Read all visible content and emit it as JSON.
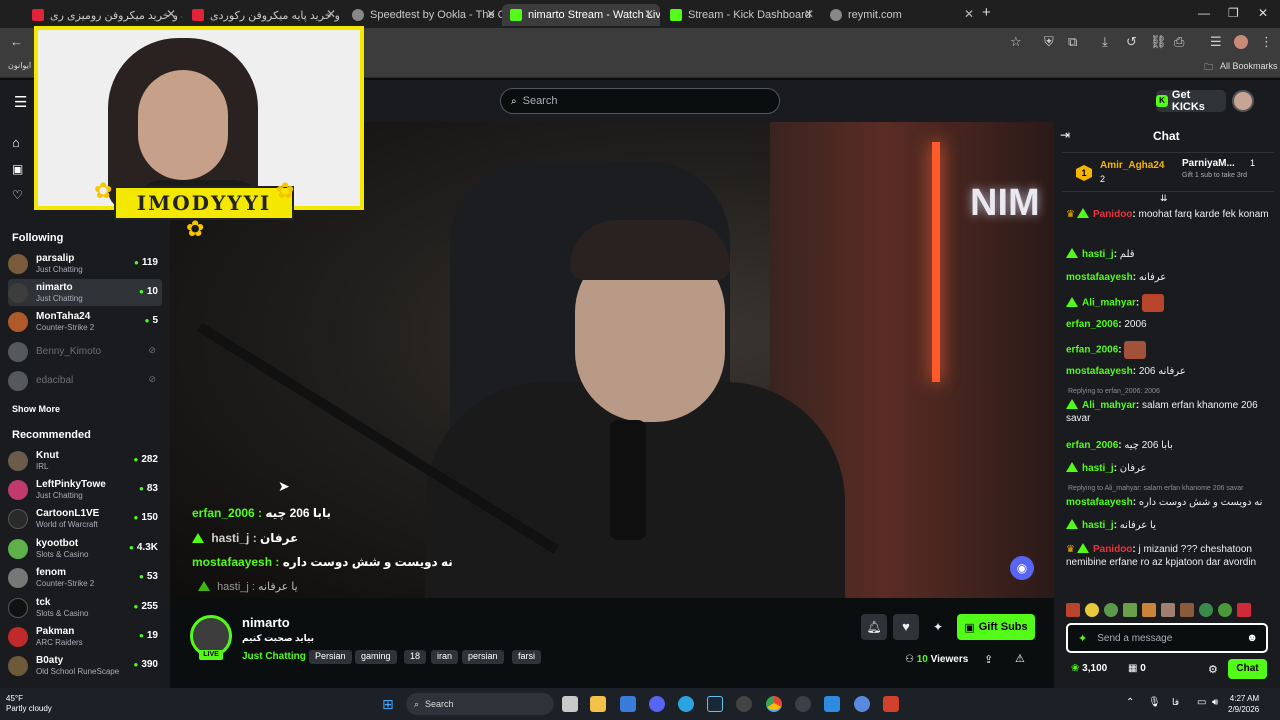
{
  "browser": {
    "tabs": [
      {
        "title": "قیمت و خرید میکروفن رومیزی ری",
        "fav": "#e0243a"
      },
      {
        "title": "قیمت و خرید پایه میکروفن رکوردی",
        "fav": "#e0243a"
      },
      {
        "title": "Speedtest by Ookla - The Glob",
        "fav": "#888888"
      },
      {
        "title": "nimarto Stream - Watch Live",
        "fav": "#53fc18"
      },
      {
        "title": "Stream - Kick Dashboard",
        "fav": "#53fc18"
      },
      {
        "title": "reymit.com",
        "fav": "#888888"
      }
    ],
    "bookmarks_label": "All Bookmarks",
    "bookmark_item": "ایوانون"
  },
  "header": {
    "search_placeholder": "Search",
    "get_kicks": "Get KICKs"
  },
  "sidebar": {
    "following_title": "Following",
    "following": [
      {
        "name": "parsalip",
        "category": "Just Chatting",
        "viewers": "119",
        "color": "#7a5c3c"
      },
      {
        "name": "nimarto",
        "category": "Just Chatting",
        "viewers": "10",
        "color": "#3d3d3d"
      },
      {
        "name": "MonTaha24",
        "category": "Counter-Strike 2",
        "viewers": "5",
        "color": "#b05a2c"
      },
      {
        "name": "Benny_Kimoto",
        "category": "",
        "viewers": "",
        "color": "#55585c"
      },
      {
        "name": "edacibal",
        "category": "",
        "viewers": "",
        "color": "#55585c"
      }
    ],
    "show_more": "Show More",
    "recommended_title": "Recommended",
    "recommended": [
      {
        "name": "Knut",
        "category": "IRL",
        "viewers": "282",
        "color": "#6b5b4b"
      },
      {
        "name": "LeftPinkyTowe",
        "category": "Just Chatting",
        "viewers": "83",
        "color": "#c03a6a"
      },
      {
        "name": "CartoonL1VE",
        "category": "World of Warcraft",
        "viewers": "150",
        "color": "#2a2a2a"
      },
      {
        "name": "kyootbot",
        "category": "Slots & Casino",
        "viewers": "4.3K",
        "color": "#5fb04a"
      },
      {
        "name": "fenom",
        "category": "Counter-Strike 2",
        "viewers": "53",
        "color": "#777777"
      },
      {
        "name": "tck",
        "category": "Slots & Casino",
        "viewers": "255",
        "color": "#111111"
      },
      {
        "name": "Pakman",
        "category": "ARC Raiders",
        "viewers": "19",
        "color": "#c02a2a"
      },
      {
        "name": "B0aty",
        "category": "Old School RuneScape",
        "viewers": "390",
        "color": "#6c5a3a"
      }
    ]
  },
  "webcam": {
    "label": "IMODYYYI"
  },
  "video_overlay_chat": [
    {
      "user": "erfan_2006 :",
      "text": "بابا 206 چیه"
    },
    {
      "user": "hasti_j :",
      "text": "عرفان"
    },
    {
      "user": "mostafaayesh :",
      "text": "نه دویست و شش دوست داره"
    },
    {
      "user": "hasti_j :",
      "text": "یا عرفانه"
    }
  ],
  "stream": {
    "channel": "nimarto",
    "title": "بیاید صحبت کنیم",
    "live_badge": "LIVE",
    "category": "Just Chatting",
    "tags": [
      "Persian",
      "gaming",
      "18",
      "iran",
      "persian",
      "farsi"
    ],
    "viewers_count": "10",
    "viewers_label": "Viewers",
    "gift_subs": "Gift Subs"
  },
  "chat": {
    "title": "Chat",
    "leader1": {
      "name": "Amir_Agha24",
      "count": "2"
    },
    "leader2": {
      "name": "ParniyaM...",
      "count": "1",
      "note": "Gift 1 sub to take 3rd"
    },
    "messages": [
      {
        "user": "Panidoo",
        "text": "moohat farq karde fek konam",
        "color": "#e8353d",
        "crown": true
      },
      {
        "user": "hasti_j",
        "text": "قلم",
        "color": "#53fc18",
        "tri": true
      },
      {
        "user": "mostafaayesh",
        "text": "عرفانه",
        "color": "#53fc18"
      },
      {
        "user": "Ali_mahyar",
        "text": "",
        "color": "#53fc18",
        "tri": true
      },
      {
        "user": "erfan_2006",
        "text": "2006",
        "color": "#53fc18"
      },
      {
        "user": "erfan_2006",
        "text": "",
        "color": "#53fc18"
      },
      {
        "user": "mostafaayesh",
        "text": "عرفانه 206",
        "color": "#53fc18"
      },
      {
        "user": "Ali_mahyar",
        "text": "salam erfan khanome 206 savar",
        "color": "#53fc18",
        "tri": true
      },
      {
        "user": "erfan_2006",
        "text": "بابا 206 چیه",
        "color": "#53fc18"
      },
      {
        "user": "hasti_j",
        "text": "عرفان",
        "color": "#53fc18",
        "tri": true
      },
      {
        "user": "mostafaayesh",
        "text": "نه دویست و شش دوست داره",
        "color": "#53fc18"
      },
      {
        "user": "hasti_j",
        "text": "یا عرفانه",
        "color": "#53fc18",
        "tri": true
      },
      {
        "user": "Panidoo",
        "text": "j mizanid ??? cheshatoon nemibine erfane ro az kpjatoon dar avordin",
        "color": "#e8353d",
        "crown": true
      }
    ],
    "reply1": "Replying to erfan_2006: 2006",
    "reply2": "Replying to Ali_mahyar: salam erfan khanome 206 savar",
    "input_placeholder": "Send a message",
    "points": "3,100",
    "redeem_count": "0",
    "send_label": "Chat"
  },
  "taskbar": {
    "weather_temp": "45°F",
    "weather_desc": "Partly cloudy",
    "search": "Search",
    "time": "4:27 AM",
    "date": "2/9/2026",
    "lang": "فا"
  }
}
